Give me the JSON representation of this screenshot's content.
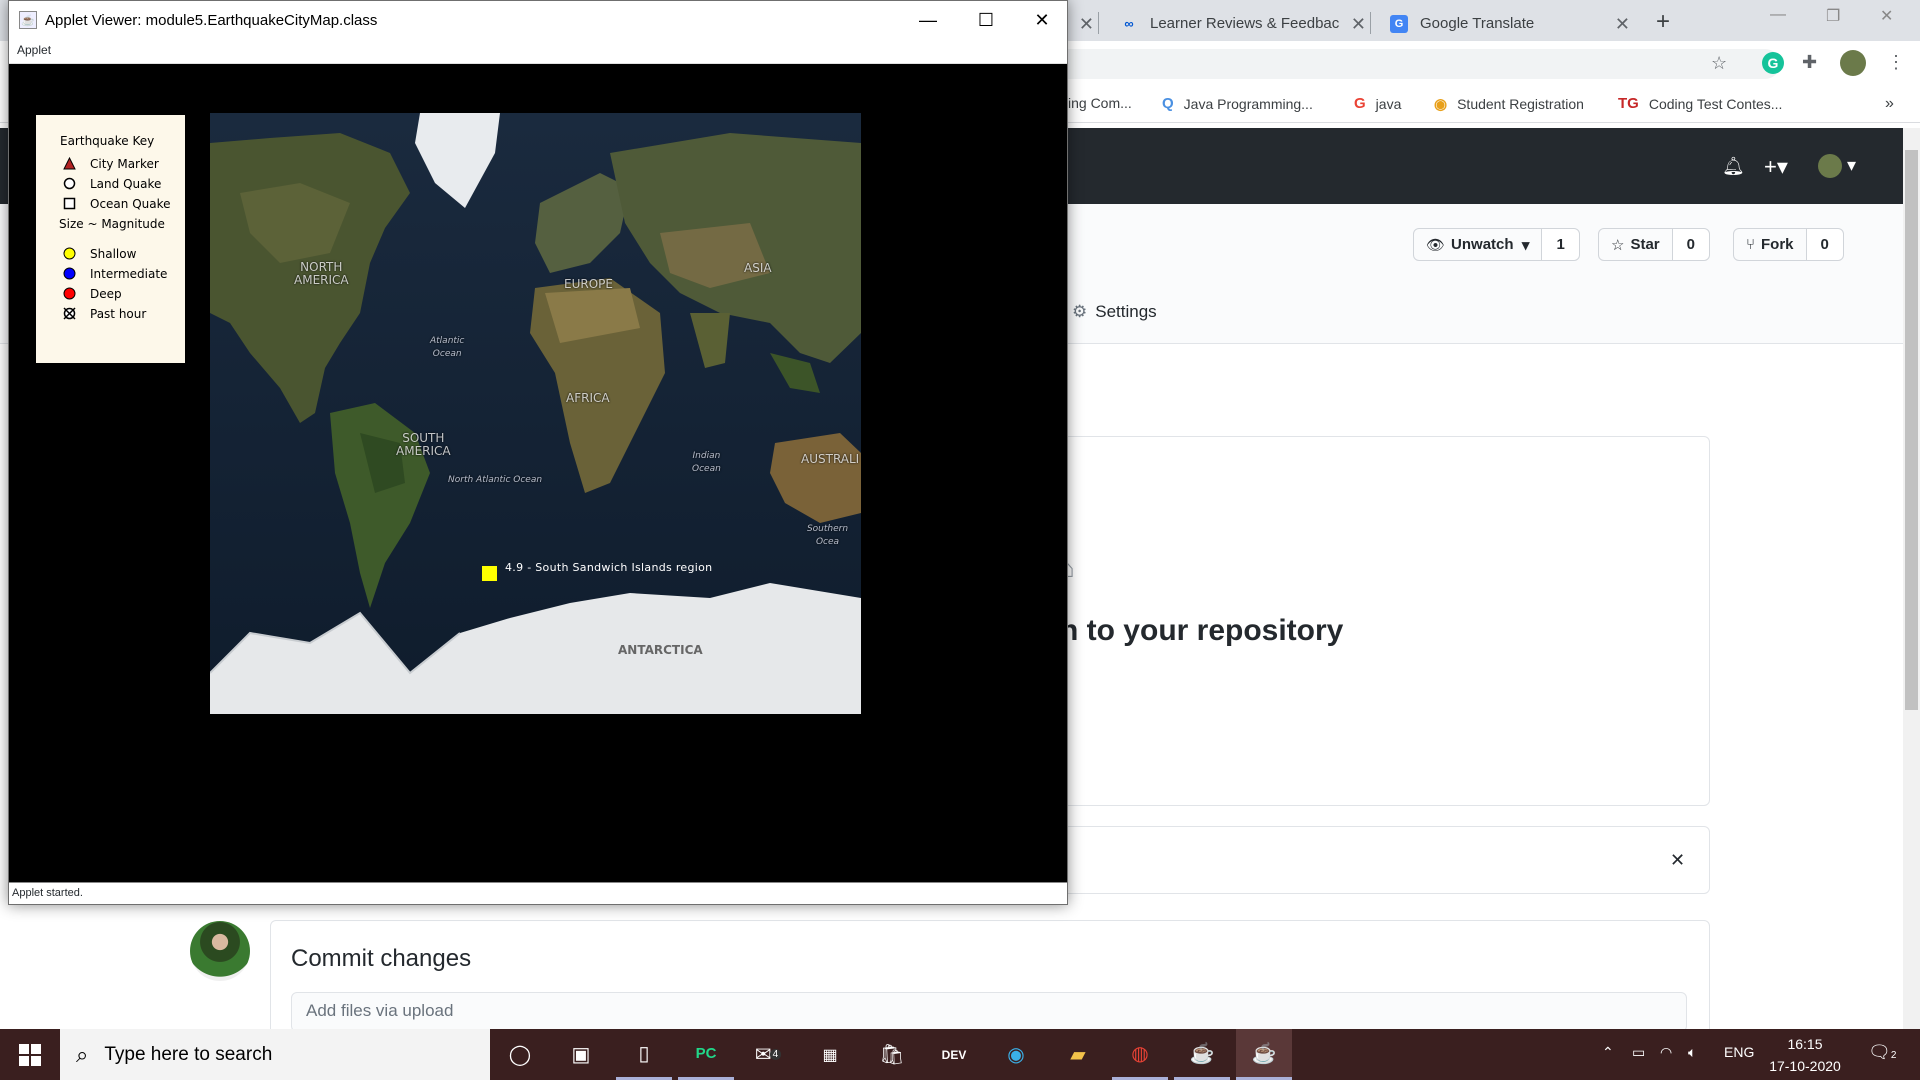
{
  "browser": {
    "tabs": [
      {
        "label": "Learner Reviews & Feedback",
        "icon": "coursera-icon"
      },
      {
        "label": "Google Translate",
        "icon": "google-translate-icon"
      }
    ],
    "bookmarks": [
      {
        "label": "ing Com...",
        "icon": "bookmark-icon"
      },
      {
        "label": "Java Programming...",
        "icon": "quora-icon"
      },
      {
        "label": "java",
        "icon": "google-icon"
      },
      {
        "label": "Student Registration",
        "icon": "registration-icon"
      },
      {
        "label": "Coding Test Contes...",
        "icon": "tg-icon"
      }
    ]
  },
  "github": {
    "unwatch": {
      "label": "Unwatch",
      "count": "1"
    },
    "star": {
      "label": "Star",
      "count": "0"
    },
    "fork": {
      "label": "Fork",
      "count": "0"
    },
    "settings_tab": "Settings",
    "drag_title": "n to your repository",
    "commit_title": "Commit changes",
    "commit_placeholder": "Add files via upload"
  },
  "applet": {
    "title": "Applet Viewer: module5.EarthquakeCityMap.class",
    "menu": "Applet",
    "status": "Applet started.",
    "key": {
      "title": "Earthquake Key",
      "items": [
        "City Marker",
        "Land Quake",
        "Ocean Quake"
      ],
      "size_note": "Size ~ Magnitude",
      "depth": [
        "Shallow",
        "Intermediate",
        "Deep",
        "Past hour"
      ],
      "colors": {
        "shallow": "#ffff00",
        "intermediate": "#0000ff",
        "deep": "#ff0000"
      }
    },
    "map": {
      "labels": {
        "north_america": "NORTH\nAMERICA",
        "europe": "EUROPE",
        "asia": "ASIA",
        "africa": "AFRICA",
        "south_america": "SOUTH\nAMERICA",
        "australia": "AUSTRALI",
        "antarctica": "ANTARCTICA",
        "atlantic": "Atlantic\nOcean",
        "indian": "Indian\nOcean",
        "north_atlantic": "North Atlantic Ocean",
        "southern": "Southern Ocea"
      },
      "quake_label": "4.9 - South Sandwich Islands region"
    }
  },
  "taskbar": {
    "search_placeholder": "Type here to search",
    "language": "ENG",
    "time": "16:15",
    "date": "17-10-2020",
    "notifications": "2",
    "mail_badge": "4"
  }
}
